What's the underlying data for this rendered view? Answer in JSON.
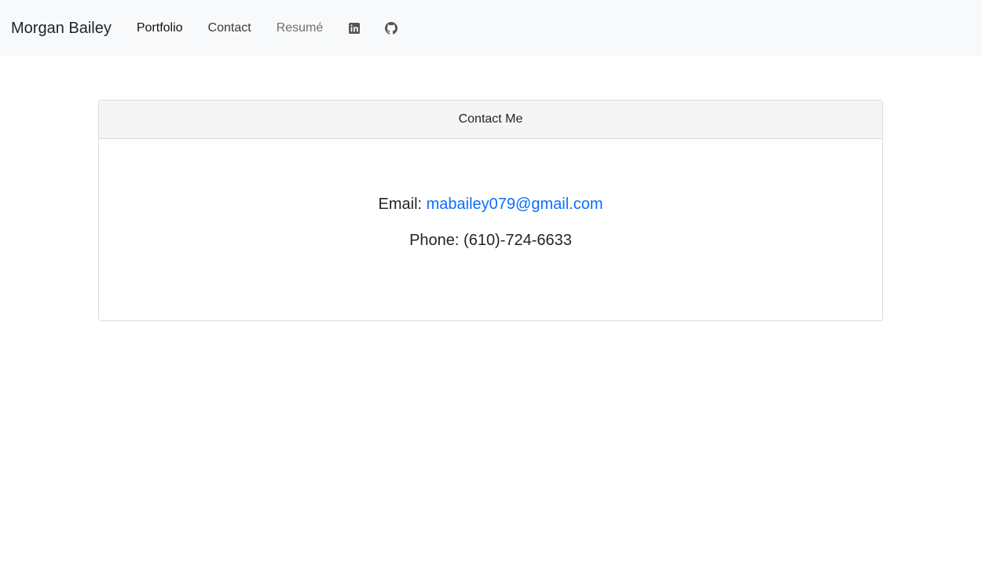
{
  "navbar": {
    "brand": "Morgan Bailey",
    "links": [
      {
        "label": "Portfolio",
        "state": "active"
      },
      {
        "label": "Contact",
        "state": "normal"
      },
      {
        "label": "Resumé",
        "state": "muted"
      }
    ],
    "icons": [
      "linkedin-icon",
      "github-icon"
    ]
  },
  "contact_card": {
    "header": "Contact Me",
    "email_label": "Email:",
    "email_value": "mabailey079@gmail.com",
    "phone_label": "Phone:",
    "phone_value": "(610)-724-6633"
  },
  "colors": {
    "navbar_bg": "#f8f9fa",
    "link_accent": "#0d6efd",
    "card_header_bg": "#f5f5f5",
    "card_border": "#dcdcdc"
  }
}
